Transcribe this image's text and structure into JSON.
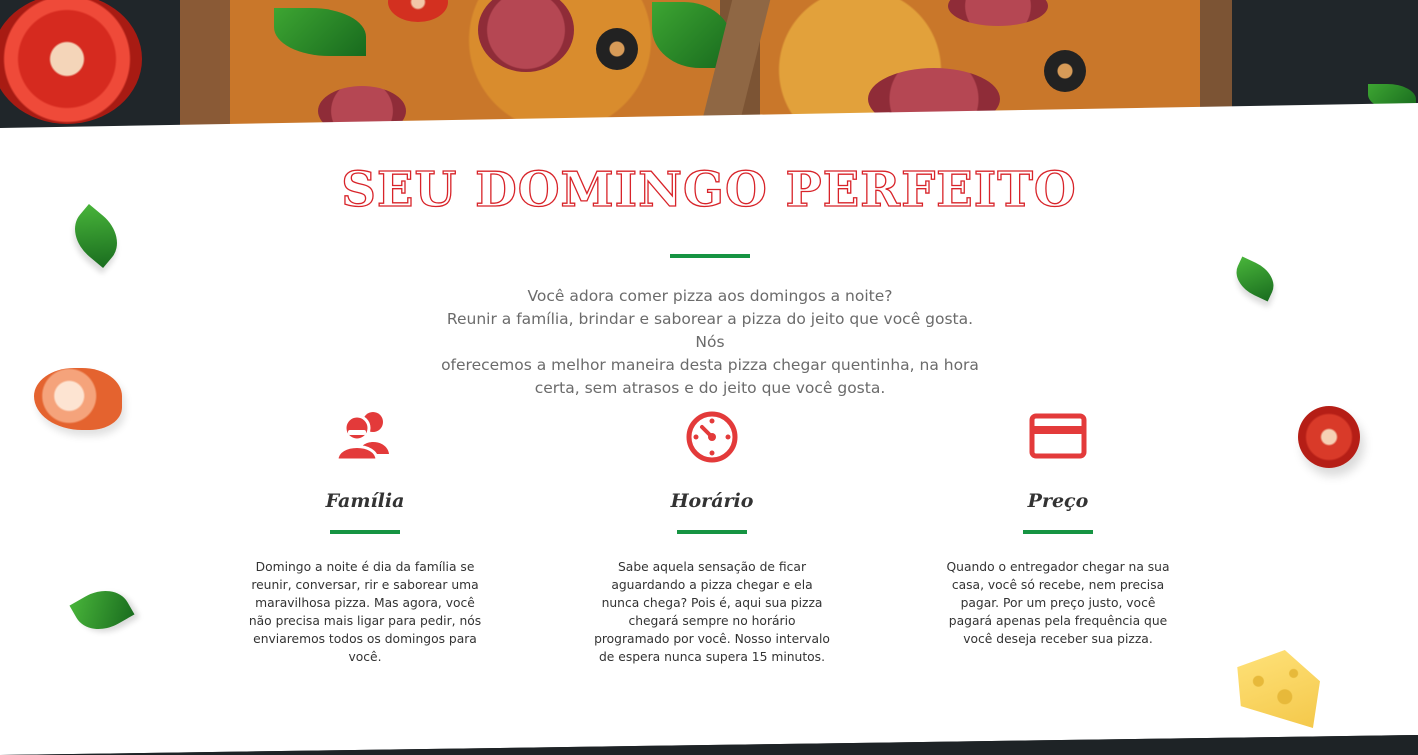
{
  "section": {
    "title": "SEU DOMINGO PERFEITO",
    "intro_lines": [
      "Você adora comer pizza aos domingos a noite?",
      "Reunir a família, brindar e saborear a pizza do jeito que você gosta. Nós",
      "oferecemos a melhor maneira desta pizza chegar quentinha, na hora",
      "certa, sem atrasos e do jeito que você gosta."
    ]
  },
  "features": [
    {
      "icon": "people-icon",
      "title": "Família",
      "text": "Domingo a noite é dia da família se reunir, conversar, rir e saborear uma maravilhosa pizza. Mas agora, você não precisa mais ligar para pedir, nós enviaremos todos os domingos para você."
    },
    {
      "icon": "timer-icon",
      "title": "Horário",
      "text": "Sabe aquela sensação de ficar aguardando a pizza chegar e ela nunca chega? Pois é, aqui sua pizza chegará sempre no horário programado por você. Nosso intervalo de espera nunca supera 15 minutos."
    },
    {
      "icon": "credit-card-icon",
      "title": "Preço",
      "text": "Quando o entregador chegar na sua casa, você só recebe, nem precisa pagar. Por um preço justo, você pagará apenas pela frequência que você deseja receber sua pizza."
    }
  ],
  "colors": {
    "accent_red": "#e33a3a",
    "accent_green": "#169442",
    "title_stroke": "#d8242a"
  }
}
